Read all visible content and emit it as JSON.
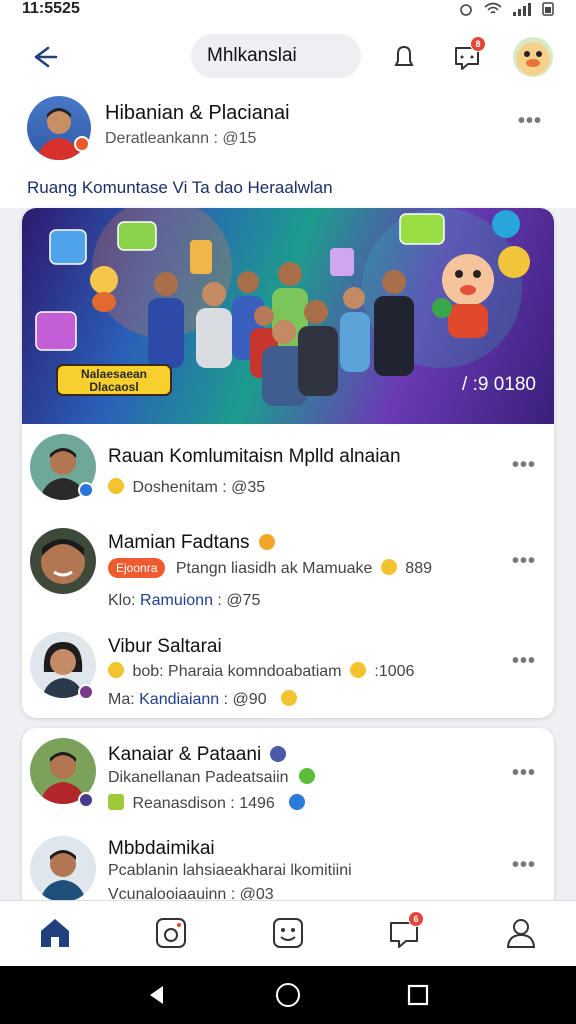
{
  "status": {
    "time": "11:5525"
  },
  "top_bar": {
    "search_text": "Mhlkanslai",
    "message_badge": "8",
    "bottom_notif_badge": "6"
  },
  "profile": {
    "name": "Hibanian & Placianai",
    "subtitle": "Deratleankann : @15"
  },
  "section_title": "Ruang Komuntase Vi Ta dao Heraalwlan",
  "banner": {
    "label": "Nalaesaean Dlacaosl",
    "count": "/ :9 0180"
  },
  "posts": [
    {
      "title": "Rauan Komlumitaisn Mplld alnaian",
      "meta": "Doshenitam : @35"
    },
    {
      "title": "Mamian Fadtans",
      "tag": "Ejoonra",
      "meta_line1": "Ptangn liasidh ak Mamuake",
      "meta_line1_count": "889",
      "meta_line2_prefix": "Klo:",
      "meta_line2_link": "Ramuionn",
      "meta_line2_suffix": ": @75"
    },
    {
      "title": "Vibur Saltarai",
      "meta_line1_prefix": "bob:",
      "meta_line1": "Pharaia komndoabatiam",
      "meta_line1_count": ":1006",
      "meta_line2_prefix": "Ma:",
      "meta_line2_link": "Kandiaiann",
      "meta_line2_suffix": ": @90"
    },
    {
      "title": "Kanaiar & Pataani",
      "meta_line1": "Dikanellanan Padeatsaiin",
      "meta_line2": "Reanasdison : 1496"
    },
    {
      "title": "Mbbdaimikai",
      "meta_line1": "Pcablanin lahsiaeakharai lkomitiini",
      "meta_line2": "Vcunalooiaauinn : @03"
    }
  ],
  "colors": {
    "accent": "#1f3f8f",
    "badge": "#e4463a",
    "tag": "#ef5b2e",
    "nav_active": "#1f3f8f"
  }
}
